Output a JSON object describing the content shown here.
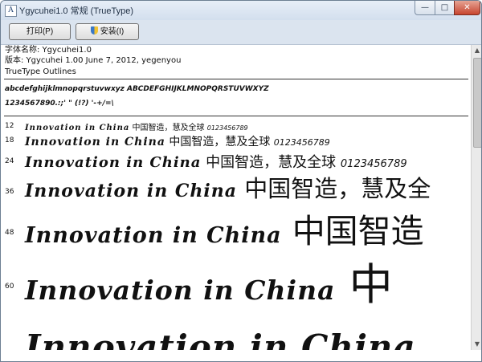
{
  "window": {
    "title": "Ygycuhei1.0 常规 (TrueType)",
    "minimize_glyph": "—",
    "maximize_glyph": "□",
    "close_glyph": "✕"
  },
  "toolbar": {
    "print_label": "打印(P)",
    "install_label": "安装(I)"
  },
  "font_info": {
    "name_line": "字体名称: Ygycuhei1.0",
    "version_line": "版本: Ygycuhei 1.00 June 7, 2012, yegenyou",
    "type_line": "TrueType Outlines"
  },
  "charset": {
    "line1": "abcdefghijklmnopqrstuvwxyz ABCDEFGHIJKLMNOPQRSTUVWXYZ",
    "line2": "1234567890.:;' \" (!?) '-+/=\\"
  },
  "sample_text": {
    "latin": "Innovation in China",
    "cjk": "中国智造，慧及全球",
    "digits": "0123456789"
  },
  "samples": [
    {
      "size": "12",
      "latin": "Innovation in China",
      "cjk": "中国智造，慧及全球",
      "digits": "0123456789"
    },
    {
      "size": "18",
      "latin": "Innovation in China",
      "cjk": "中国智造，慧及全球",
      "digits": "0123456789"
    },
    {
      "size": "24",
      "latin": "Innovation in China",
      "cjk": "中国智造，慧及全球",
      "digits": "0123456789"
    },
    {
      "size": "36",
      "latin": "Innovation in China",
      "cjk": "中国智造，慧及全",
      "digits": ""
    },
    {
      "size": "48",
      "latin": "Innovation in China",
      "cjk": "中国智造",
      "digits": ""
    },
    {
      "size": "60",
      "latin": "Innovation in China",
      "cjk": "中",
      "digits": ""
    },
    {
      "size": "",
      "latin": "Innovation in China",
      "cjk": "",
      "digits": ""
    }
  ],
  "icons": {
    "app_icon": "font-file-icon",
    "install_icon": "uac-shield-icon"
  }
}
